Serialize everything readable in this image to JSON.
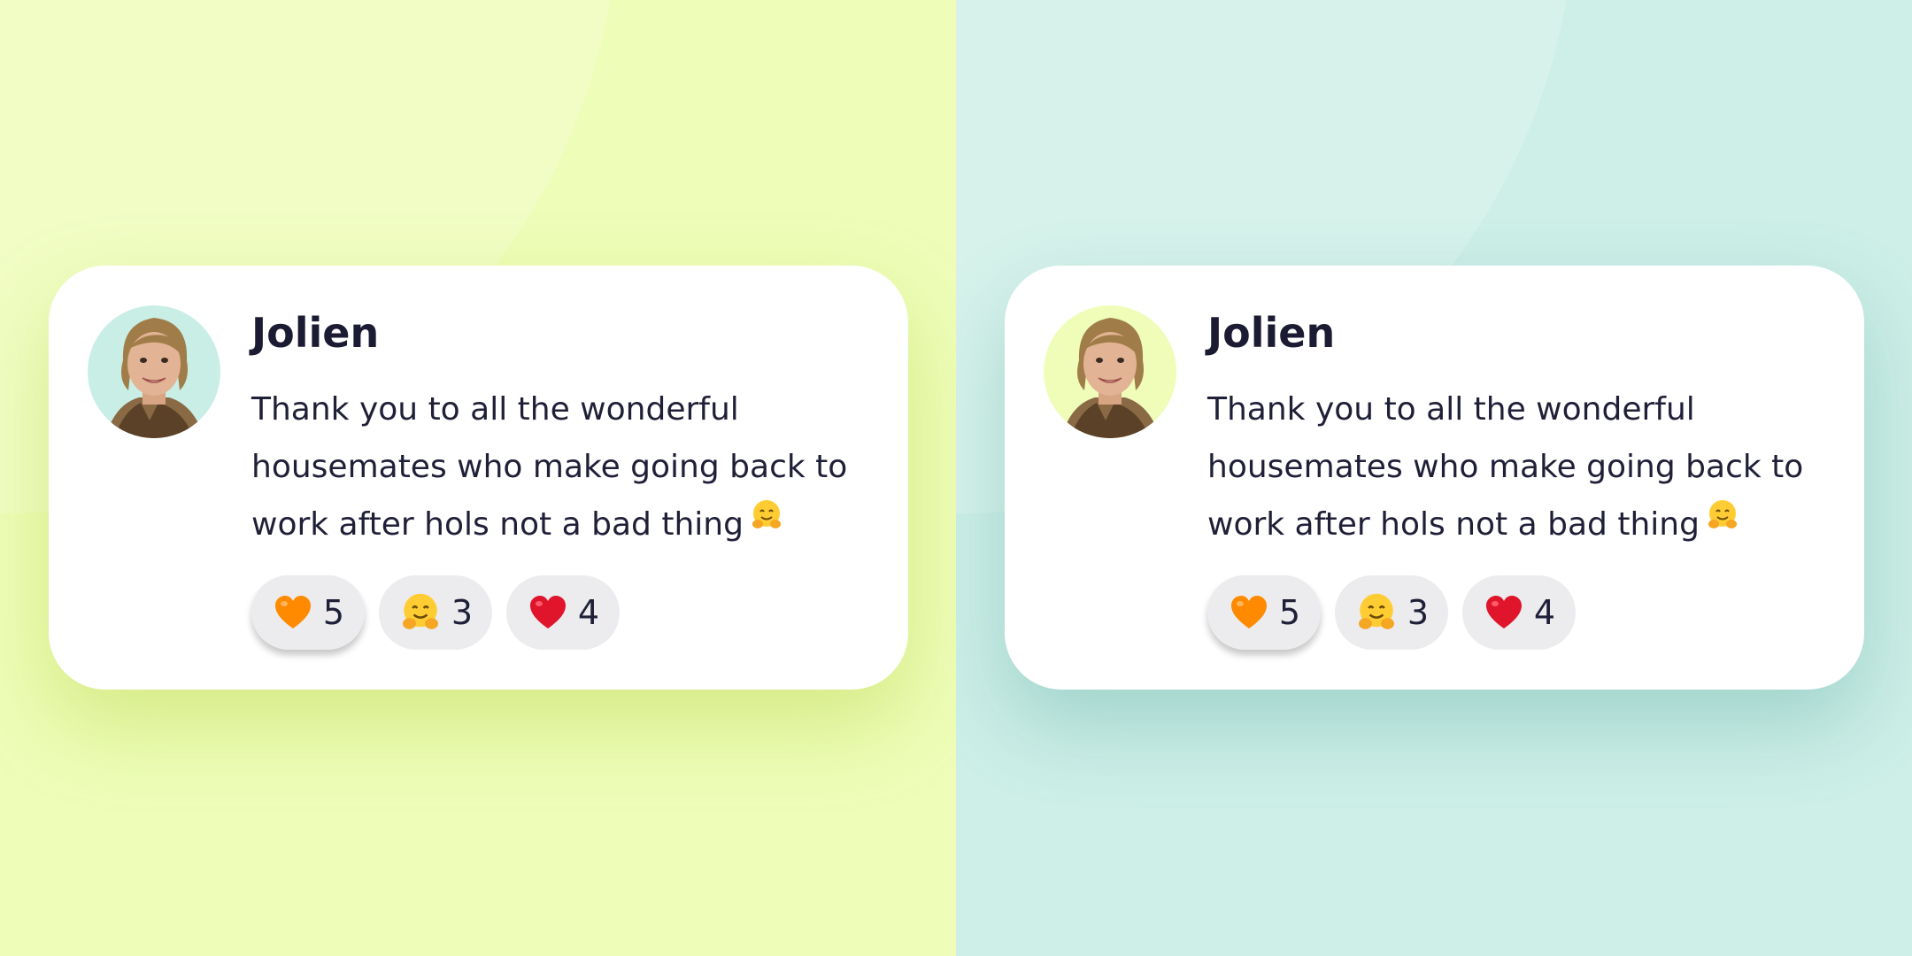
{
  "panels": [
    {
      "theme": "lime",
      "background": "#eefdb8",
      "avatar_background": "#c9eee6",
      "post": {
        "author": "Jolien",
        "message": "Thank you to all the wonderful housemates who make going back to work after hols not a bad thing",
        "message_emoji": "hugging-face-icon",
        "reactions": [
          {
            "icon": "orange-heart-icon",
            "count": "5",
            "selected": true
          },
          {
            "icon": "hugging-face-icon",
            "count": "3",
            "selected": false
          },
          {
            "icon": "red-heart-icon",
            "count": "4",
            "selected": false
          }
        ]
      }
    },
    {
      "theme": "mint",
      "background": "#cdefe7",
      "avatar_background": "#effdb9",
      "post": {
        "author": "Jolien",
        "message": "Thank you to all the wonderful housemates who make going back to work after hols not a bad thing",
        "message_emoji": "hugging-face-icon",
        "reactions": [
          {
            "icon": "orange-heart-icon",
            "count": "5",
            "selected": true
          },
          {
            "icon": "hugging-face-icon",
            "count": "3",
            "selected": false
          },
          {
            "icon": "red-heart-icon",
            "count": "4",
            "selected": false
          }
        ]
      }
    }
  ],
  "colors": {
    "text": "#1b1b33",
    "card": "#ffffff",
    "pill": "#ececee",
    "orange_heart": "#ff8a00",
    "red_heart": "#e0142b"
  }
}
